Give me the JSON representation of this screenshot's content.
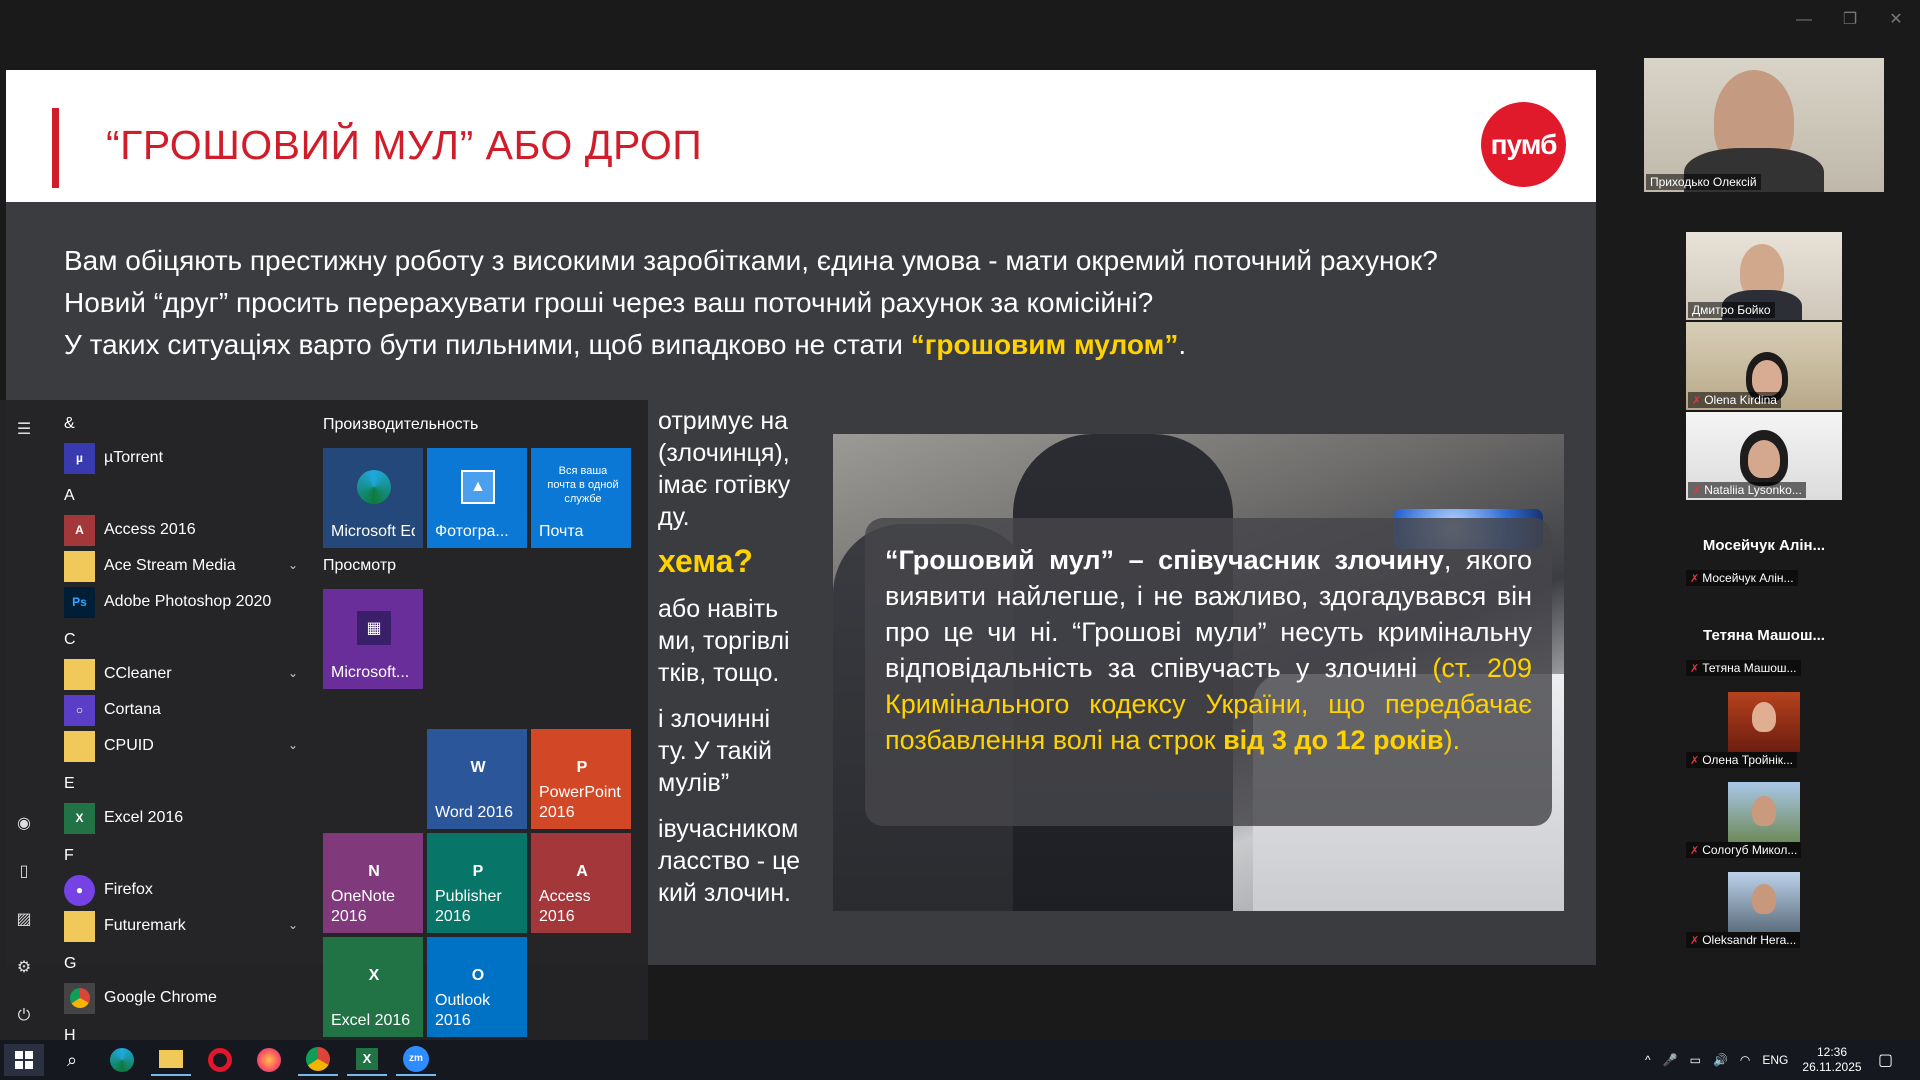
{
  "slide": {
    "title": "“ГРОШОВИЙ МУЛ” АБО ДРОП",
    "logo": "пумб",
    "intro_lines": [
      "Вам обіцяють престижну роботу з високими заробітками, єдина умова - мати окремий поточний рахунок?",
      "Новий “друг” просить перерахувати гроші через ваш поточний рахунок за комісійні?"
    ],
    "intro_line3_prefix": "У таких ситуаціях варто бути пильними, щоб випадково не стати ",
    "intro_line3_highlight": "“грошовим мулом”",
    "intro_line3_suffix": ".",
    "left_fragments": [
      "отримує на",
      "(злочинця),",
      "імає готівку",
      "ду.",
      "хема?",
      "або навіть",
      "ми, торгівлі",
      "тків, тощо.",
      "і злочинні",
      "ту. У такій",
      "мулів”",
      "івучасником",
      "ласство - це",
      "кий злочин."
    ],
    "quote": {
      "bold_part": "“Грошовий мул” – співучасник злочину",
      "normal_part": ", якого виявити найлегше, і не важливо, здогадувався він про це чи ні. “Грошові мули” несуть кримінальну відповідальність за співучасть у злочині ",
      "yellow_part": "(ст. 209 Кримінального кодексу України, що передбачає позбавлення волі на строк ",
      "yellow_bold_part": "від 3 до 12 років",
      "yellow_end": ")."
    }
  },
  "participants": {
    "video": [
      {
        "name": "Приходько Олексій",
        "muted": false
      },
      {
        "name": "Дмитро Бойко",
        "muted": false
      },
      {
        "name": "Olena Kirdina",
        "muted": true
      },
      {
        "name": "Nataliia Lysonko...",
        "muted": true
      }
    ],
    "named": [
      {
        "title": "Мосейчук Алін...",
        "label": "Мосейчук Алін..."
      },
      {
        "title": "Тетяна Машош...",
        "label": "Тетяна Машош..."
      }
    ],
    "small": [
      {
        "name": "Олена Тройнік..."
      },
      {
        "name": "Сологуб Микол..."
      },
      {
        "name": "Oleksandr Hera..."
      }
    ]
  },
  "start_menu": {
    "letters": [
      "&",
      "A",
      "C",
      "E",
      "F",
      "G",
      "H"
    ],
    "apps": [
      {
        "name": "µTorrent",
        "icon": "torrent-icon",
        "color": "#3a3ab0"
      },
      {
        "name": "Access 2016",
        "icon": "access-icon",
        "color": "#a4373a"
      },
      {
        "name": "Ace Stream Media",
        "icon": "folder-icon",
        "color": "#f1c95a"
      },
      {
        "name": "Adobe Photoshop 2020",
        "icon": "photoshop-icon",
        "color": "#001e36"
      },
      {
        "name": "CCleaner",
        "icon": "folder-icon",
        "color": "#f1c95a"
      },
      {
        "name": "Cortana",
        "icon": "cortana-icon",
        "color": "#5a3ec8"
      },
      {
        "name": "CPUID",
        "icon": "folder-icon",
        "color": "#f1c95a"
      },
      {
        "name": "Excel 2016",
        "icon": "excel-icon",
        "color": "#217346"
      },
      {
        "name": "Firefox",
        "icon": "firefox-icon",
        "color": "#7542e5"
      },
      {
        "name": "Futuremark",
        "icon": "folder-icon",
        "color": "#f1c95a"
      },
      {
        "name": "Google Chrome",
        "icon": "chrome-icon",
        "color": "#444"
      }
    ],
    "groups": [
      "Производительность",
      "Просмотр"
    ],
    "tiles": [
      {
        "label": "Microsoft Edge",
        "label2": "Edge",
        "color": "#24487a"
      },
      {
        "label": "Фотогра...",
        "color": "#0a78d4"
      },
      {
        "label": "Почта",
        "note": "Вся ваша почта в одной службе",
        "color": "#0a78d4"
      },
      {
        "label": "Microsoft...",
        "color": "#6a2e9a"
      },
      {
        "label": "Word 2016",
        "letter": "W",
        "color": "#2b579a"
      },
      {
        "label": "PowerPoint 2016",
        "letter": "P",
        "color": "#d24726"
      },
      {
        "label": "OneNote 2016",
        "letter": "N",
        "color": "#80397b"
      },
      {
        "label": "Publisher 2016",
        "letter": "P",
        "color": "#077568"
      },
      {
        "label": "Access 2016",
        "letter": "A",
        "color": "#a4373a"
      },
      {
        "label": "Excel 2016",
        "letter": "X",
        "color": "#217346"
      },
      {
        "label": "Outlook 2016",
        "letter": "O",
        "color": "#0072c6"
      }
    ]
  },
  "taskbar": {
    "lang": "ENG",
    "time": "12:36",
    "date": "26.11.2025"
  },
  "colors": {
    "accent_red": "#d11c2a",
    "highlight_yellow": "#ffd200"
  }
}
